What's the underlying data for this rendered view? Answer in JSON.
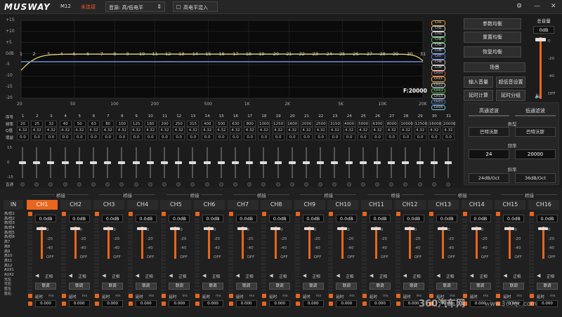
{
  "topbar": {
    "logo": "MUSWAY",
    "model": "M12",
    "connection": "未连接",
    "source": "音源: 高/低电平",
    "source_arrow": "⇕",
    "high_level_mix": "高电平混入",
    "icons": [
      "tool-icon",
      "minimize-icon",
      "close-icon"
    ]
  },
  "graph": {
    "y_labels": [
      "+15",
      "+10",
      "+5",
      "0dB",
      "-5",
      "-10",
      "-15",
      "-20"
    ],
    "x_labels": [
      "20",
      "50",
      "100",
      "200",
      "500",
      "1K",
      "2K",
      "5K",
      "10K",
      "20K"
    ],
    "band_markers": [
      "1",
      "2",
      "3",
      "4",
      "5",
      "6",
      "7",
      "8",
      "9",
      "10",
      "11",
      "12",
      "13",
      "14",
      "15",
      "16",
      "17",
      "18",
      "19",
      "20",
      "21",
      "22",
      "23",
      "24",
      "25",
      "26",
      "27",
      "28",
      "29",
      "30",
      "31"
    ],
    "freq_readout": "F:20000"
  },
  "channel_legend": [
    {
      "label": "CH1",
      "color": "#e8a23a"
    },
    {
      "label": "CH2",
      "color": "#cfcfcf"
    },
    {
      "label": "CH3",
      "color": "#d8d8d8"
    },
    {
      "label": "CH4",
      "color": "#3fbf4a"
    },
    {
      "label": "CH5",
      "color": "#e0e0e0"
    },
    {
      "label": "CH6",
      "color": "#7fb6e8"
    },
    {
      "label": "CH7",
      "color": "#5f79e8"
    },
    {
      "label": "CH8",
      "color": "#b9b9b9"
    },
    {
      "label": "CH9",
      "color": "#e0e0e0"
    },
    {
      "label": "CH10",
      "color": "#e44f3a"
    },
    {
      "label": "CH11",
      "color": "#e8b13a"
    },
    {
      "label": "CH12",
      "color": "#e0e0e0"
    },
    {
      "label": "CH13",
      "color": "#3fc04a"
    },
    {
      "label": "CH14",
      "color": "#e0e0e0"
    },
    {
      "label": "CH15",
      "color": "#4a7fe8"
    },
    {
      "label": "CH16",
      "color": "#7bd1e8"
    }
  ],
  "right_buttons": {
    "eq_params": "参数均衡",
    "reset_eq": "重置均衡",
    "restore_eq": "恢复均衡",
    "scene": "场景",
    "input_volume": "输入音量",
    "ultra_bass": "超低音设置",
    "delay_calc": "延时计算",
    "delay_group": "延时分组"
  },
  "master": {
    "title": "总音量",
    "value": "0dB",
    "scale": [
      "0",
      "-20",
      "-40",
      "OFF"
    ]
  },
  "band_table": {
    "row_labels": [
      "序号",
      "频率",
      "Q值",
      "增益"
    ],
    "index": [
      "1",
      "2",
      "3",
      "4",
      "5",
      "6",
      "7",
      "8",
      "9",
      "10",
      "11",
      "12",
      "13",
      "14",
      "15",
      "16",
      "17",
      "18",
      "19",
      "20",
      "21",
      "22",
      "23",
      "24",
      "25",
      "26",
      "27",
      "28",
      "29",
      "30",
      "31"
    ],
    "freq": [
      "20",
      "25",
      "32",
      "40",
      "50",
      "63",
      "80",
      "100",
      "125",
      "160",
      "200",
      "250",
      "315",
      "400",
      "500",
      "630",
      "800",
      "1000",
      "1250",
      "1600",
      "2000",
      "2500",
      "3150",
      "4000",
      "5000",
      "6300",
      "8000",
      "10000",
      "12500",
      "16000",
      "20000"
    ],
    "q": "4.32",
    "gain": "0.0",
    "fader_scale": [
      "15",
      "0",
      "-15"
    ],
    "bypass_label": "直通"
  },
  "filter": {
    "hp_tab": "高通滤波",
    "lp_tab": "低通滤波",
    "type_label": "类型",
    "hp_type": "巴特沃斯",
    "lp_type": "巴特沃斯",
    "freq_label": "频率",
    "hp_freq": "24",
    "lp_freq": "20000",
    "slope_label": "斜率",
    "hp_slope": "24dB/Oct",
    "lp_slope": "36dB/Oct"
  },
  "bridge_label": "桥接",
  "input_panel": {
    "title": "IN",
    "items": [
      "高/低1",
      "高/低2",
      "高/低3",
      "高/低4",
      "高/低5",
      "高/低6",
      "高7",
      "高8",
      "高9",
      "高10",
      "高11",
      "高12",
      "AUX1",
      "AUX2",
      "光左",
      "光右",
      "蓝左",
      "蓝右"
    ]
  },
  "channels": [
    {
      "name": "CH1",
      "level": "0.0dB",
      "delay": "0.000",
      "active": true
    },
    {
      "name": "CH2",
      "level": "0.0dB",
      "delay": "0.000",
      "active": false
    },
    {
      "name": "CH3",
      "level": "0.0dB",
      "delay": "0.000",
      "active": false
    },
    {
      "name": "CH4",
      "level": "0.0dB",
      "delay": "0.000",
      "active": false
    },
    {
      "name": "CH5",
      "level": "0.0dB",
      "delay": "0.000",
      "active": false
    },
    {
      "name": "CH6",
      "level": "0.0dB",
      "delay": "0.000",
      "active": false
    },
    {
      "name": "CH7",
      "level": "0.0dB",
      "delay": "0.000",
      "active": false
    },
    {
      "name": "CH8",
      "level": "0.0dB",
      "delay": "0.000",
      "active": false
    },
    {
      "name": "CH9",
      "level": "0.0dB",
      "delay": "0.000",
      "active": false
    },
    {
      "name": "CH10",
      "level": "0.0dB",
      "delay": "0.000",
      "active": false
    },
    {
      "name": "CH11",
      "level": "0.0dB",
      "delay": "0.000",
      "active": false
    },
    {
      "name": "CH12",
      "level": "0.0dB",
      "delay": "0.000",
      "active": false
    },
    {
      "name": "CH13",
      "level": "0.0dB",
      "delay": "0.000",
      "active": false
    },
    {
      "name": "CH14",
      "level": "0.0dB",
      "delay": "0.000",
      "active": false
    },
    {
      "name": "CH15",
      "level": "0.0dB",
      "delay": "0.000",
      "active": false
    },
    {
      "name": "CH16",
      "level": "0.0dB",
      "delay": "0.000",
      "active": false
    }
  ],
  "strip_labels": {
    "scale": [
      "0",
      "-20",
      "-40",
      "OFF"
    ],
    "phase": "正相",
    "link": "联调",
    "delay": "延时",
    "unit": "ms"
  },
  "watermark": {
    "brand": "360汽车网",
    "url": "www.360qc.com"
  }
}
